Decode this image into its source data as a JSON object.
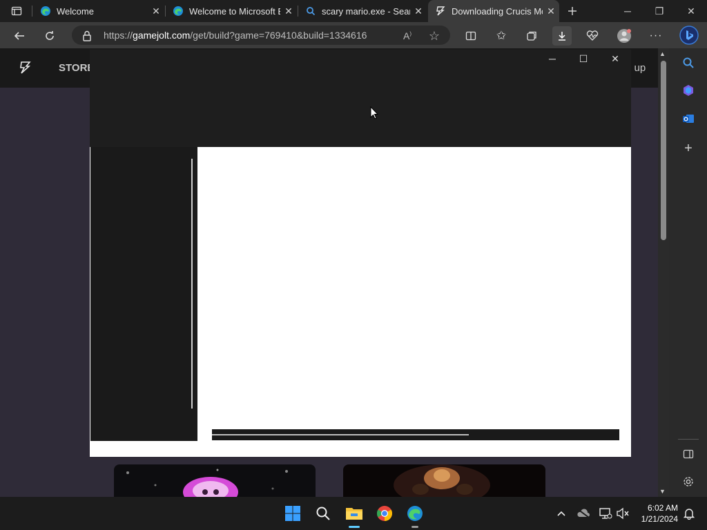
{
  "tabs": [
    {
      "title": "Welcome",
      "icon": "edge-icon"
    },
    {
      "title": "Welcome to Microsoft E",
      "icon": "edge-icon"
    },
    {
      "title": "scary mario.exe - Searc",
      "icon": "search-icon"
    },
    {
      "title": "Downloading Crucis Mo",
      "icon": "gamejolt-icon",
      "active": true
    }
  ],
  "address": {
    "prefix": "https://",
    "host": "gamejolt.com",
    "path": "/get/build?game=769410&build=1334616"
  },
  "site": {
    "store_label": "STORE",
    "signup_label": "n up"
  },
  "popup": {
    "progress_fraction": 0.63
  },
  "taskbar": {
    "time": "6:02 AM",
    "date": "1/21/2024"
  },
  "colors": {
    "accent": "#ccff00",
    "page_bg": "#2f2b38",
    "popup_top": "#1e1e1e"
  }
}
